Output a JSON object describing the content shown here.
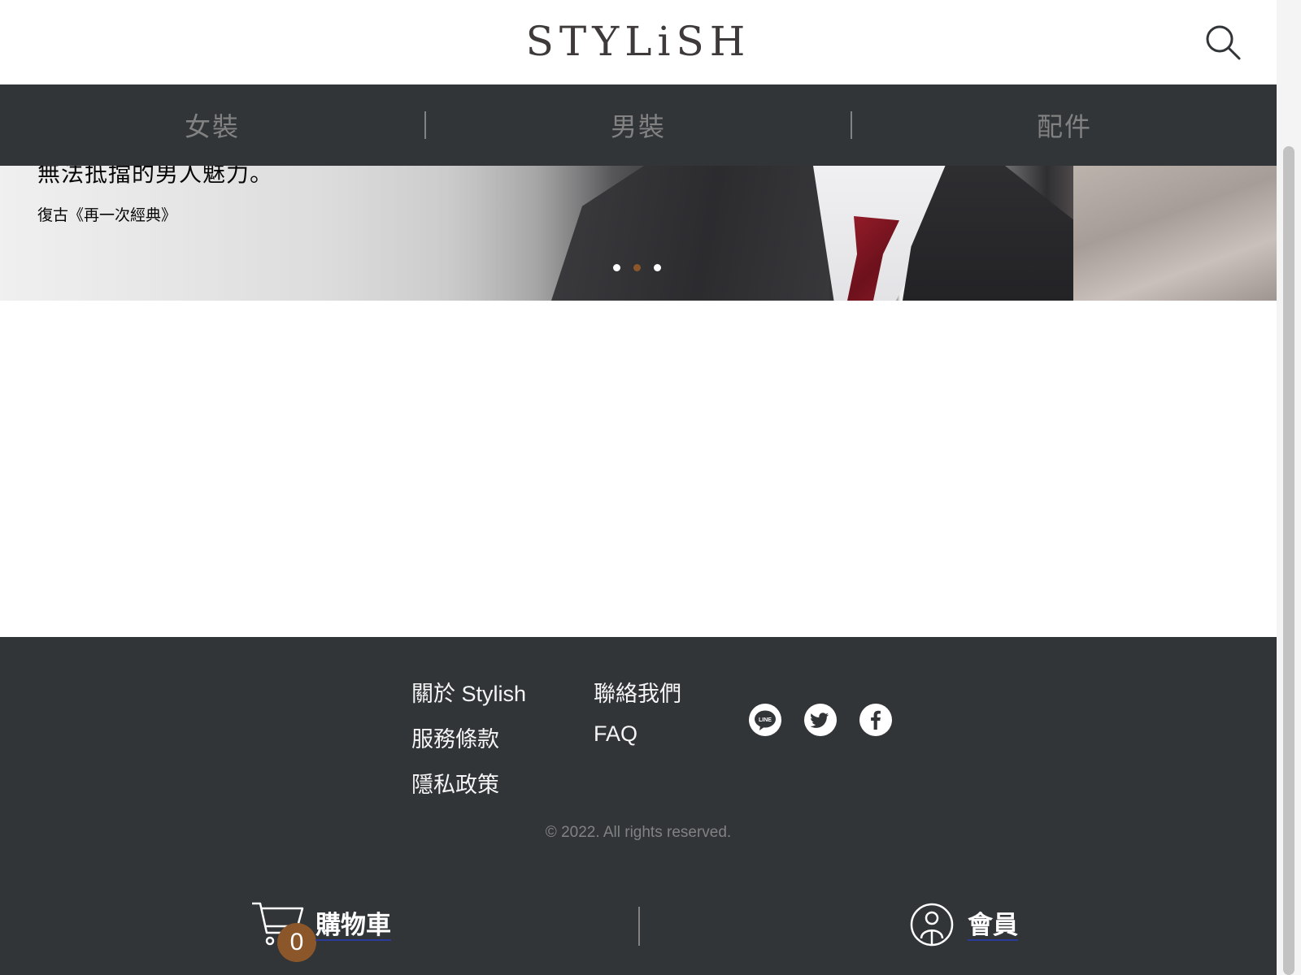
{
  "header": {
    "logo_text": "STYLiSH",
    "search_icon": "search-icon"
  },
  "nav": {
    "items": [
      {
        "label": "女裝"
      },
      {
        "label": "男裝"
      },
      {
        "label": "配件"
      }
    ]
  },
  "hero": {
    "title": "無法抵擋的男人魅力。",
    "subtitle": "復古《再一次經典》",
    "slides_count": 3,
    "active_slide": 2,
    "active_dot_color": "#8b572a"
  },
  "footer": {
    "links_col1": [
      "關於 Stylish",
      "服務條款",
      "隱私政策"
    ],
    "links_col2": [
      "聯絡我們",
      "FAQ"
    ],
    "social": [
      "line-icon",
      "twitter-icon",
      "facebook-icon"
    ],
    "copyright": "© 2022. All rights reserved.",
    "background": "#313538"
  },
  "bottom_bar": {
    "cart_label": "購物車",
    "cart_count": "0",
    "member_label": "會員",
    "badge_color": "#8b572a"
  }
}
